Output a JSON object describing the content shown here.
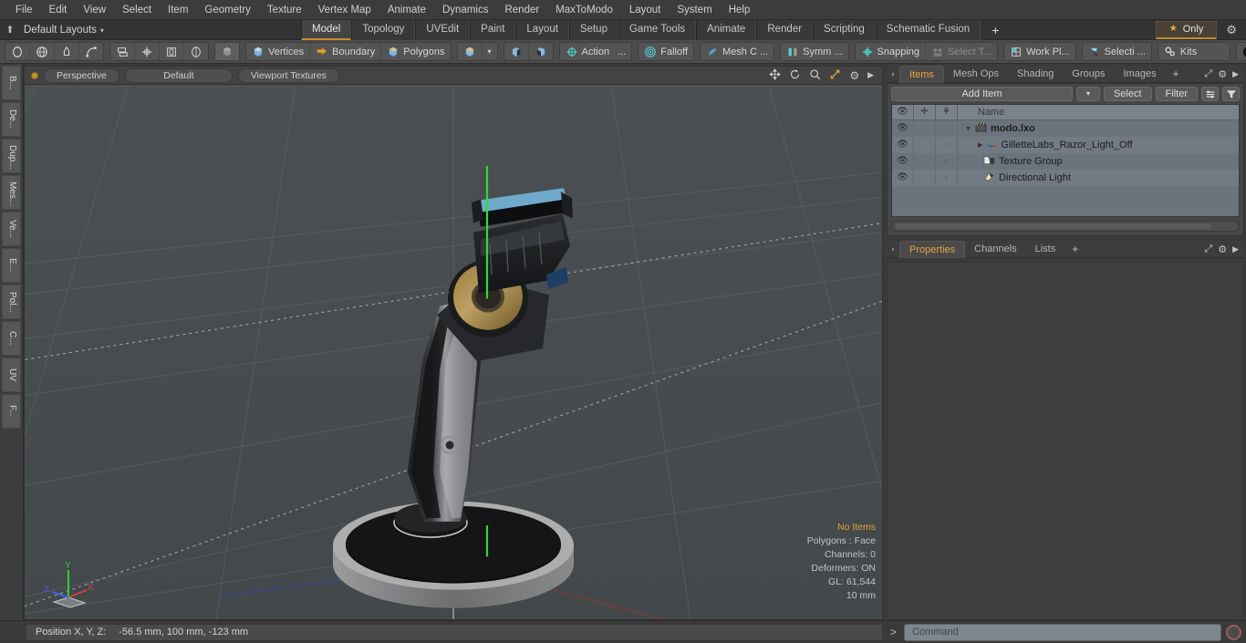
{
  "menubar": {
    "items": [
      "File",
      "Edit",
      "View",
      "Select",
      "Item",
      "Geometry",
      "Texture",
      "Vertex Map",
      "Animate",
      "Dynamics",
      "Render",
      "MaxToModo",
      "Layout",
      "System",
      "Help"
    ]
  },
  "layoutbar": {
    "home_icon": "home-icon",
    "layouts_label": "Default Layouts",
    "caret": "▾",
    "tabs": [
      {
        "label": "Model",
        "active": true
      },
      {
        "label": "Topology",
        "active": false
      },
      {
        "label": "UVEdit",
        "active": false
      },
      {
        "label": "Paint",
        "active": false
      },
      {
        "label": "Layout",
        "active": false
      },
      {
        "label": "Setup",
        "active": false
      },
      {
        "label": "Game Tools",
        "active": false
      },
      {
        "label": "Animate",
        "active": false
      },
      {
        "label": "Render",
        "active": false
      },
      {
        "label": "Scripting",
        "active": false
      },
      {
        "label": "Schematic Fusion",
        "active": false
      }
    ],
    "plus": "+",
    "only_label": "Only",
    "only_star": "★",
    "gear": "⚙"
  },
  "toolbar": {
    "shape_tools": [
      "circle-icon",
      "sphere-icon",
      "pen-icon",
      "curve-icon"
    ],
    "transform_tools": [
      "stack-icon",
      "move-icon",
      "rotate-icon",
      "scale-icon"
    ],
    "mode_single": "cube-grey-icon",
    "selection_modes": [
      {
        "label": "Vertices",
        "icon": "cube-vertices-icon",
        "selected": false
      },
      {
        "label": "Boundary",
        "icon": "boundary-arrow-icon",
        "selected": false
      },
      {
        "label": "Polygons",
        "icon": "cube-polygons-icon",
        "selected": false
      }
    ],
    "item_mode_icon": "cube-item-icon",
    "item_mode_caret": "▾",
    "snap_icons": [
      "select-through-icon",
      "select-backface-icon"
    ],
    "action_label": "Action",
    "action_dots": "...",
    "falloff_label": "Falloff",
    "mesh_constraint_label": "Mesh C ...",
    "symmetry_label": "Symm ...",
    "snapping_label": "Snapping",
    "select_through_label": "Select T...",
    "work_plane_label": "Work Pl...",
    "selection_set_label": "Selecti ...",
    "kits_label": "Kits",
    "end_icons": [
      "modo-cube-icon",
      "unreal-engine-icon"
    ]
  },
  "left_strip": {
    "tabs": [
      "B...",
      "De...",
      "Dup...",
      "Mes...",
      "Ve...",
      "E...",
      "Pol...",
      "C...",
      "UV",
      "F..."
    ]
  },
  "viewport": {
    "header": {
      "dot": "viewport-active-dot",
      "pills": [
        "Perspective",
        "Default",
        "Viewport Textures"
      ],
      "tools": [
        "move-view-icon",
        "rotate-view-icon",
        "zoom-view-icon",
        "fit-view-icon",
        "gear-icon",
        "play-arrow-icon"
      ]
    },
    "stats": {
      "no_items": "No Items",
      "polygons": "Polygons : Face",
      "channels": "Channels: 0",
      "deformers": "Deformers: ON",
      "gl": "GL: 61,544",
      "grid": "10 mm"
    },
    "axis_gizmo": {
      "x": "X",
      "y": "Y",
      "z": "Z"
    },
    "colors": {
      "background": "#4a4f52",
      "grid_line": "#565c60",
      "axis_x": "#b43a3a",
      "axis_y": "#3fcf3f",
      "axis_z": "#3a52c8"
    }
  },
  "right_panel": {
    "tabs": [
      {
        "label": "Items",
        "active": true
      },
      {
        "label": "Mesh Ops",
        "active": false
      },
      {
        "label": "Shading",
        "active": false
      },
      {
        "label": "Groups",
        "active": false
      },
      {
        "label": "Images",
        "active": false
      }
    ],
    "plus": "+",
    "controls": {
      "add_item": "Add Item",
      "add_item_caret": "▾",
      "select": "Select",
      "filter": "Filter",
      "list_icon": "list-view-icon",
      "funnel_icon": "funnel-icon"
    },
    "tree": {
      "columns": [
        "eye-icon",
        "move-icon",
        "axis-icon",
        "Name"
      ],
      "rows": [
        {
          "name": "modo.lxo",
          "icon": "scene-clapper-icon",
          "indent": 0,
          "expander": "▼",
          "visible": true,
          "bold": true
        },
        {
          "name": "GilletteLabs_Razor_Light_Off",
          "icon": "mesh-axis-icon",
          "indent": 1,
          "expander": "▶",
          "visible": true,
          "bold": false
        },
        {
          "name": "Texture Group",
          "icon": "texture-folder-icon",
          "indent": 1,
          "expander": "",
          "visible": true,
          "bold": false
        },
        {
          "name": "Directional Light",
          "icon": "light-icon",
          "indent": 1,
          "expander": "",
          "visible": true,
          "bold": false
        }
      ]
    },
    "properties_tabs": [
      {
        "label": "Properties",
        "active": true
      },
      {
        "label": "Channels",
        "active": false
      },
      {
        "label": "Lists",
        "active": false
      }
    ],
    "properties_plus": "+"
  },
  "statusbar": {
    "position_label": "Position X, Y, Z:",
    "position_value": "-56.5 mm,  100 mm,  -123 mm",
    "command_caret": ">",
    "command_placeholder": "Command",
    "record_icon": "record-icon"
  }
}
